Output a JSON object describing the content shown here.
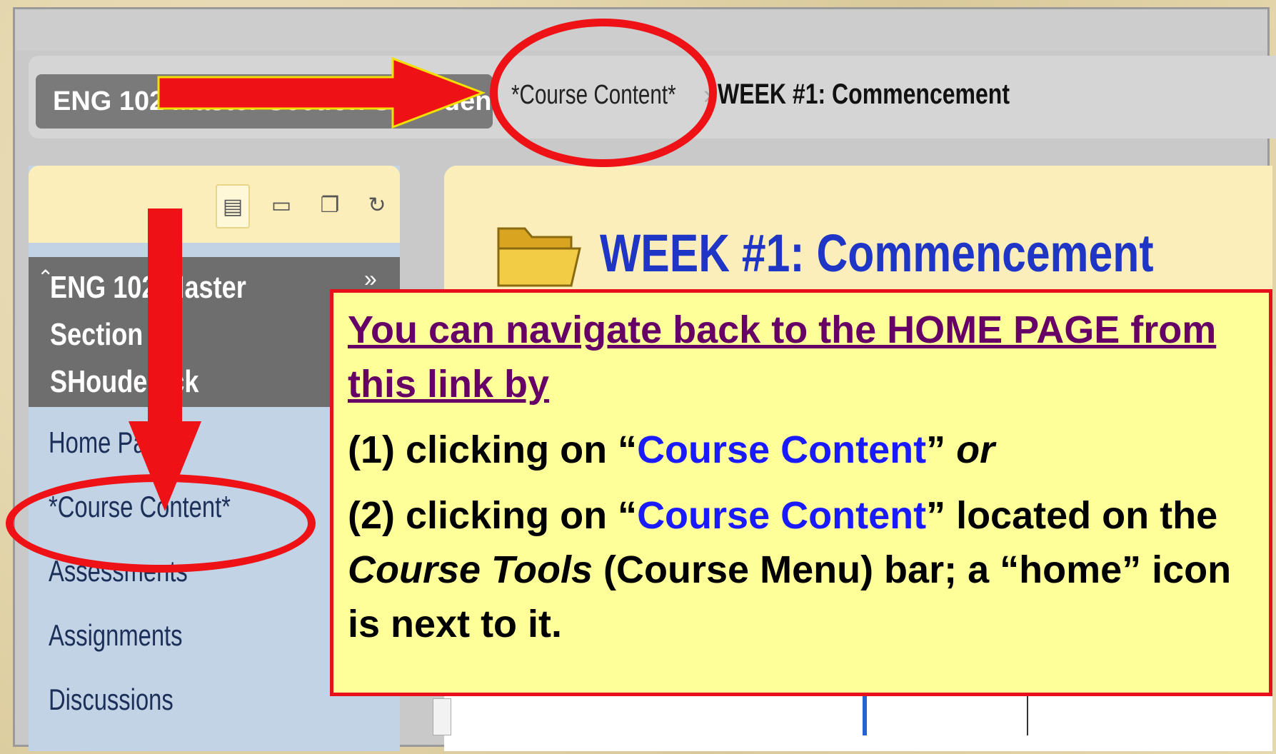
{
  "breadcrumb": {
    "course": "ENG 102 Master Section SHoudenick",
    "course_content": "*Course Content*",
    "separator": "›",
    "current": "WEEK #1: Commencement"
  },
  "course_menu": {
    "toolbar_icons": [
      "list-view-icon",
      "folder-view-icon",
      "window-icon",
      "refresh-icon"
    ],
    "course_title": "ENG 102 Master Section SHoudenick",
    "items": [
      {
        "label": "Home Page"
      },
      {
        "label": "*Course Content*"
      },
      {
        "label": "Assessments"
      },
      {
        "label": "Assignments"
      },
      {
        "label": "Discussions"
      }
    ]
  },
  "content": {
    "title": "WEEK #1: Commencement"
  },
  "callout": {
    "title": "You can navigate back to the HOME PAGE from this link by",
    "step1_prefix": "(1) clicking on “",
    "step1_link": "Course Content",
    "step1_suffix": "” ",
    "step1_or": "or",
    "step2_prefix": "(2) clicking on “",
    "step2_link": "Course Content",
    "step2_mid": "” located on the ",
    "step2_tools": "Course Tools",
    "step2_suffix": " (Course Menu) bar; a “home” icon is next to it."
  },
  "colors": {
    "annotation_red": "#ee1115",
    "callout_bg": "#ffff99",
    "link_blue": "#1a1aff",
    "title_purple": "#660066",
    "week_title_blue": "#1f35c6"
  }
}
